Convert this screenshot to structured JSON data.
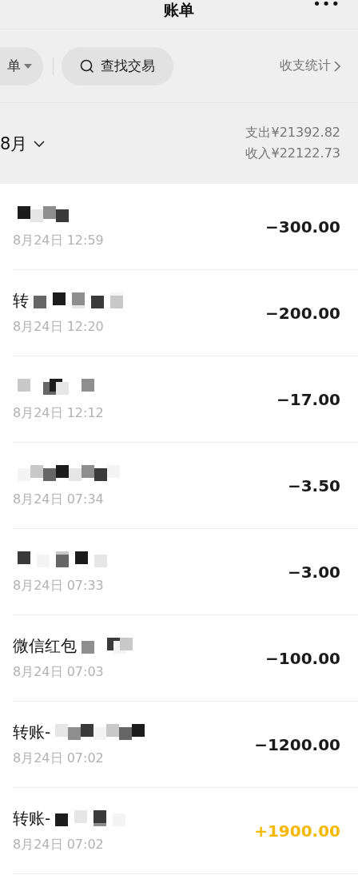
{
  "header": {
    "title": "账单",
    "menu": "•••"
  },
  "filters": {
    "bill_type": "单",
    "search": "查找交易",
    "stats": "收支统计"
  },
  "summary": {
    "month": "8月",
    "expense": "支出¥21392.82",
    "income": "收入¥22122.73"
  },
  "transactions": [
    {
      "redacted": true,
      "date": "8月24日 12:59",
      "amount": "−300.00",
      "color": "#1a1a1a"
    },
    {
      "title": "转",
      "redacted": true,
      "date": "8月24日 12:20",
      "amount": "−200.00",
      "color": "#1a1a1a"
    },
    {
      "redacted": true,
      "date": "8月24日 12:12",
      "amount": "−17.00",
      "color": "#1a1a1a"
    },
    {
      "redacted": true,
      "date": "8月24日 07:34",
      "amount": "−3.50",
      "color": "#1a1a1a"
    },
    {
      "redacted": true,
      "date": "8月24日 07:33",
      "amount": "−3.00",
      "color": "#1a1a1a"
    },
    {
      "title": "微信红包",
      "redacted": true,
      "date": "8月24日 07:03",
      "amount": "−100.00",
      "color": "#1a1a1a"
    },
    {
      "title": "转账-",
      "redacted": true,
      "date": "8月24日 07:02",
      "amount": "−1200.00",
      "color": "#1a1a1a"
    },
    {
      "title": "转账-",
      "redacted": true,
      "date": "8月24日 07:02",
      "amount": "+1900.00",
      "color": "#f5b800"
    }
  ]
}
